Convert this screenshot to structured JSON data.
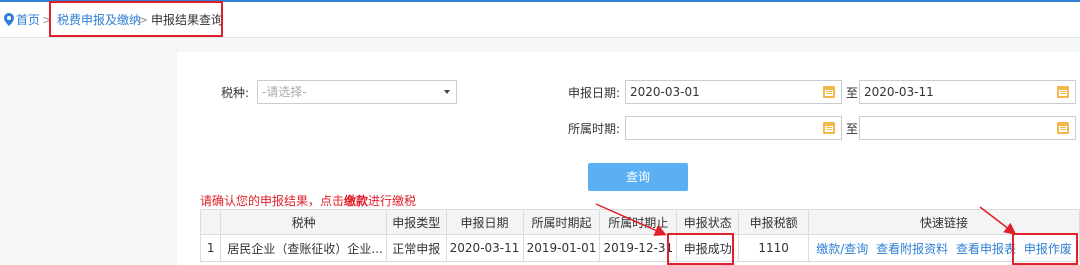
{
  "breadcrumb": {
    "home": "首页",
    "separator": ">",
    "section": "税费申报及缴纳",
    "current": "申报结果查询"
  },
  "form": {
    "tax_type_label": "税种:",
    "tax_type_placeholder": "-请选择-",
    "declare_date_label": "申报日期:",
    "declare_date_from": "2020-03-01",
    "declare_date_to": "2020-03-11",
    "to_label": "至",
    "period_label": "所属时期:",
    "period_from": "",
    "period_to": "",
    "query_button": "查询"
  },
  "notice": {
    "prefix": "请确认您的申报结果，点击",
    "bold": "缴款",
    "suffix": "进行缴税"
  },
  "table": {
    "headers": [
      "",
      "税种",
      "申报类型",
      "申报日期",
      "所属时期起",
      "所属时期止",
      "申报状态",
      "申报税额",
      "快速链接"
    ],
    "rows": [
      {
        "index": "1",
        "tax_type": "居民企业（查账征收）企业...",
        "declare_type": "正常申报",
        "declare_date": "2020-03-11",
        "period_start": "2019-01-01",
        "period_end": "2019-12-31",
        "status": "申报成功",
        "amount": "1110",
        "links": [
          "缴款/查询",
          "查看附报资料",
          "查看申报表",
          "申报作废"
        ]
      }
    ]
  },
  "colors": {
    "accent_blue": "#2f7fd6",
    "button_blue": "#5ab0f3",
    "highlight_red": "#e0202a",
    "calendar_orange": "#f2b84b"
  }
}
